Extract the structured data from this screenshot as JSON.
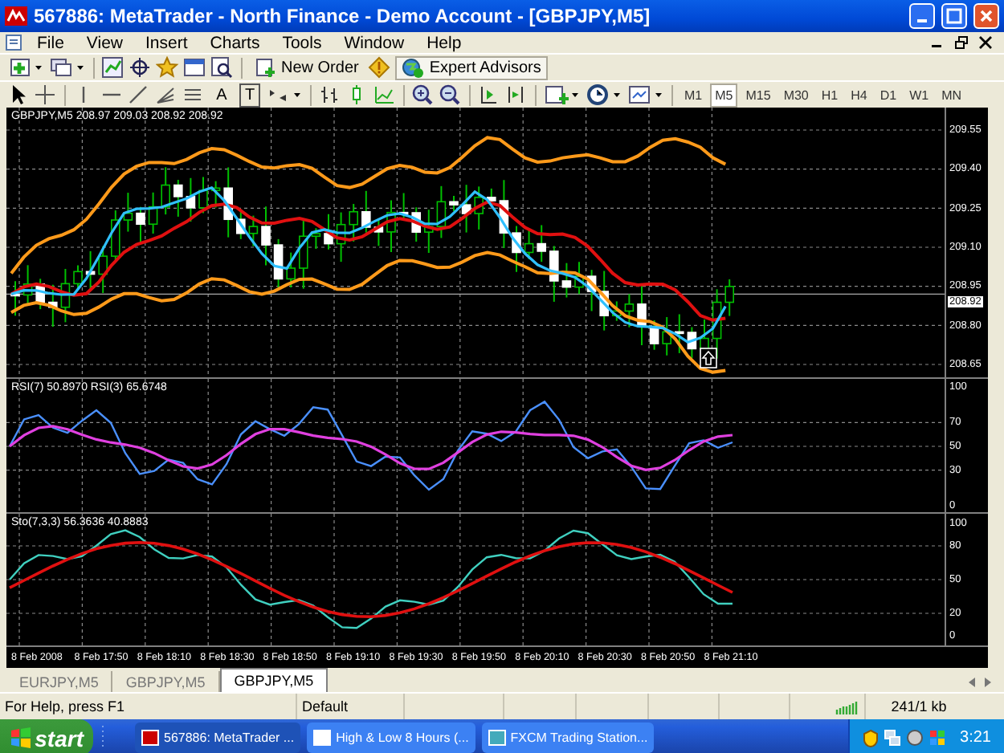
{
  "window": {
    "title": "567886: MetaTrader - North Finance - Demo Account - [GBPJPY,M5]"
  },
  "menu": [
    "File",
    "View",
    "Insert",
    "Charts",
    "Tools",
    "Window",
    "Help"
  ],
  "toolbar": {
    "new_order": "New Order",
    "expert_advisors": {
      "label": "Expert Advisors",
      "pressed": true
    },
    "text_tools": [
      "A",
      "T"
    ]
  },
  "timeframes": [
    {
      "label": "M1",
      "selected": false
    },
    {
      "label": "M5",
      "selected": true
    },
    {
      "label": "M15",
      "selected": false
    },
    {
      "label": "M30",
      "selected": false
    },
    {
      "label": "H1",
      "selected": false
    },
    {
      "label": "H4",
      "selected": false
    },
    {
      "label": "D1",
      "selected": false
    },
    {
      "label": "W1",
      "selected": false
    },
    {
      "label": "MN",
      "selected": false
    }
  ],
  "chart": {
    "header": "GBPJPY,M5  208.97 209.03 208.92 208.92",
    "price_labels": [
      "209.55",
      "209.40",
      "209.25",
      "209.10",
      "208.95",
      "208.80",
      "208.65"
    ],
    "current_price": "208.92",
    "time_labels": [
      "8 Feb 2008",
      "8 Feb 17:50",
      "8 Feb 18:10",
      "8 Feb 18:30",
      "8 Feb 18:50",
      "8 Feb 19:10",
      "8 Feb 19:30",
      "8 Feb 19:50",
      "8 Feb 20:10",
      "8 Feb 20:30",
      "8 Feb 20:50",
      "8 Feb 21:10"
    ]
  },
  "rsi": {
    "header": "RSI(7) 50.8970  RSI(3) 65.6748",
    "levels": [
      "100",
      "70",
      "50",
      "30",
      "0"
    ]
  },
  "stochastic": {
    "header": "Sto(7,3,3) 56.3636 40.8883",
    "levels": [
      "100",
      "80",
      "50",
      "20",
      "0"
    ]
  },
  "chart_tabs": [
    {
      "label": "EURJPY,M5",
      "selected": false
    },
    {
      "label": "GBPJPY,M5",
      "selected": false
    },
    {
      "label": "GBPJPY,M5",
      "selected": true
    }
  ],
  "status_bar": {
    "help": "For Help, press F1",
    "profile": "Default",
    "traffic": "241/1 kb"
  },
  "taskbar": {
    "start": "start",
    "tasks": [
      {
        "label": "567886: MetaTrader ...",
        "selected": true
      },
      {
        "label": "High & Low 8 Hours (...",
        "selected": false
      },
      {
        "label": "FXCM Trading Station...",
        "selected": false
      }
    ],
    "clock": "3:21"
  }
}
